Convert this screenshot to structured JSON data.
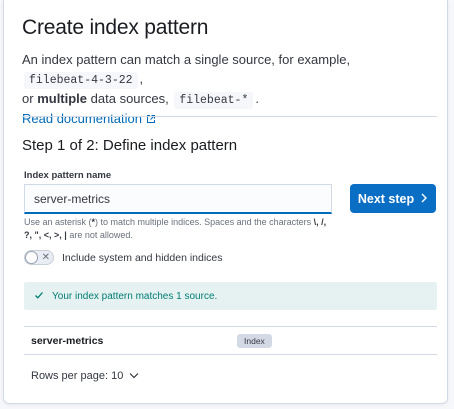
{
  "header": {
    "title": "Create index pattern",
    "desc_part1": "An index pattern can match a single source, for example,",
    "example_single": "filebeat-4-3-22",
    "desc_part2": ",",
    "desc_or": "or",
    "desc_bold": "multiple",
    "desc_part3": "data sources,",
    "example_multi": "filebeat-*",
    "desc_part4": ".",
    "doc_link": "Read documentation"
  },
  "step": {
    "title": "Step 1 of 2: Define index pattern",
    "field_label": "Index pattern name",
    "field_value": "server-metrics",
    "next_button": "Next step",
    "help_part1": "Use an asterisk (",
    "help_star": "*",
    "help_part2": ") to match multiple indices. Spaces and the characters",
    "help_chars1": "\\, /,",
    "help_chars2": "?, \", <, >, |",
    "help_part3": "are not allowed.",
    "toggle_label": "Include system and hidden indices",
    "callout": "Your index pattern matches 1 source."
  },
  "table": {
    "rows": [
      {
        "name": "server-metrics",
        "type": "Index"
      }
    ],
    "rows_per_page": "Rows per page: 10"
  },
  "colors": {
    "primary": "#0a6fc4",
    "link": "#006bb8",
    "success_bg": "#e6f2f1",
    "success_text": "#017d73"
  },
  "icons": {
    "external": "external-link-icon",
    "next": "chevron-right-icon",
    "check": "check-icon",
    "toggle_off": "cross-icon",
    "rows_dropdown": "chevron-down-icon"
  }
}
